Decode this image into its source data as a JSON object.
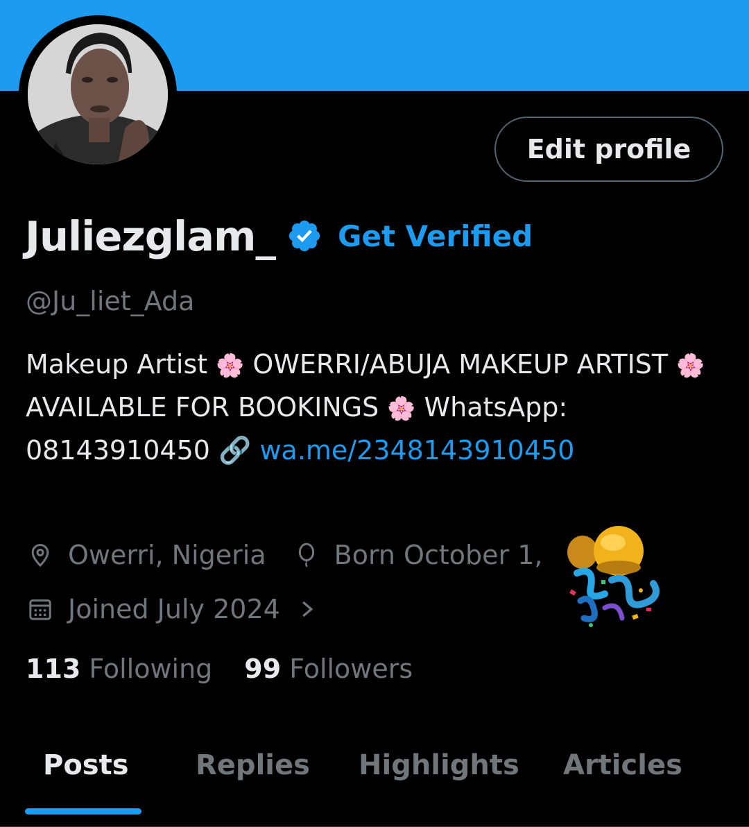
{
  "profile": {
    "display_name": "Juliezglam_",
    "verified_label": "Get Verified",
    "handle": "@Ju_liet_Ada",
    "edit_button": "Edit profile"
  },
  "bio": {
    "text_1": "Makeup Artist ",
    "text_2": " OWERRI/ABUJA MAKEUP ARTIST ",
    "text_3": " AVAILABLE FOR BOOKINGS ",
    "text_4": " WhatsApp: 08143910450 ",
    "flower": "🌸",
    "link_emoji": "🔗",
    "link_text": "wa.me/2348143910450"
  },
  "meta": {
    "location": "Owerri, Nigeria",
    "birthday": "Born October 1,",
    "joined": "Joined July 2024"
  },
  "stats": {
    "following_count": "113",
    "following_label": "Following",
    "followers_count": "99",
    "followers_label": "Followers"
  },
  "tabs": [
    {
      "label": "Posts",
      "active": true
    },
    {
      "label": "Replies",
      "active": false
    },
    {
      "label": "Highlights",
      "active": false
    },
    {
      "label": "Articles",
      "active": false
    }
  ],
  "colors": {
    "accent": "#1d9bf0",
    "background": "#000000",
    "primary_text": "#e7e9ea",
    "secondary_text": "#71767b"
  },
  "icons": {
    "verified": "verified-badge-icon",
    "location": "location-pin-icon",
    "birthday": "balloon-icon",
    "joined": "calendar-icon",
    "chevron": "chevron-right-icon",
    "confetti": "party-popper-emoji"
  }
}
